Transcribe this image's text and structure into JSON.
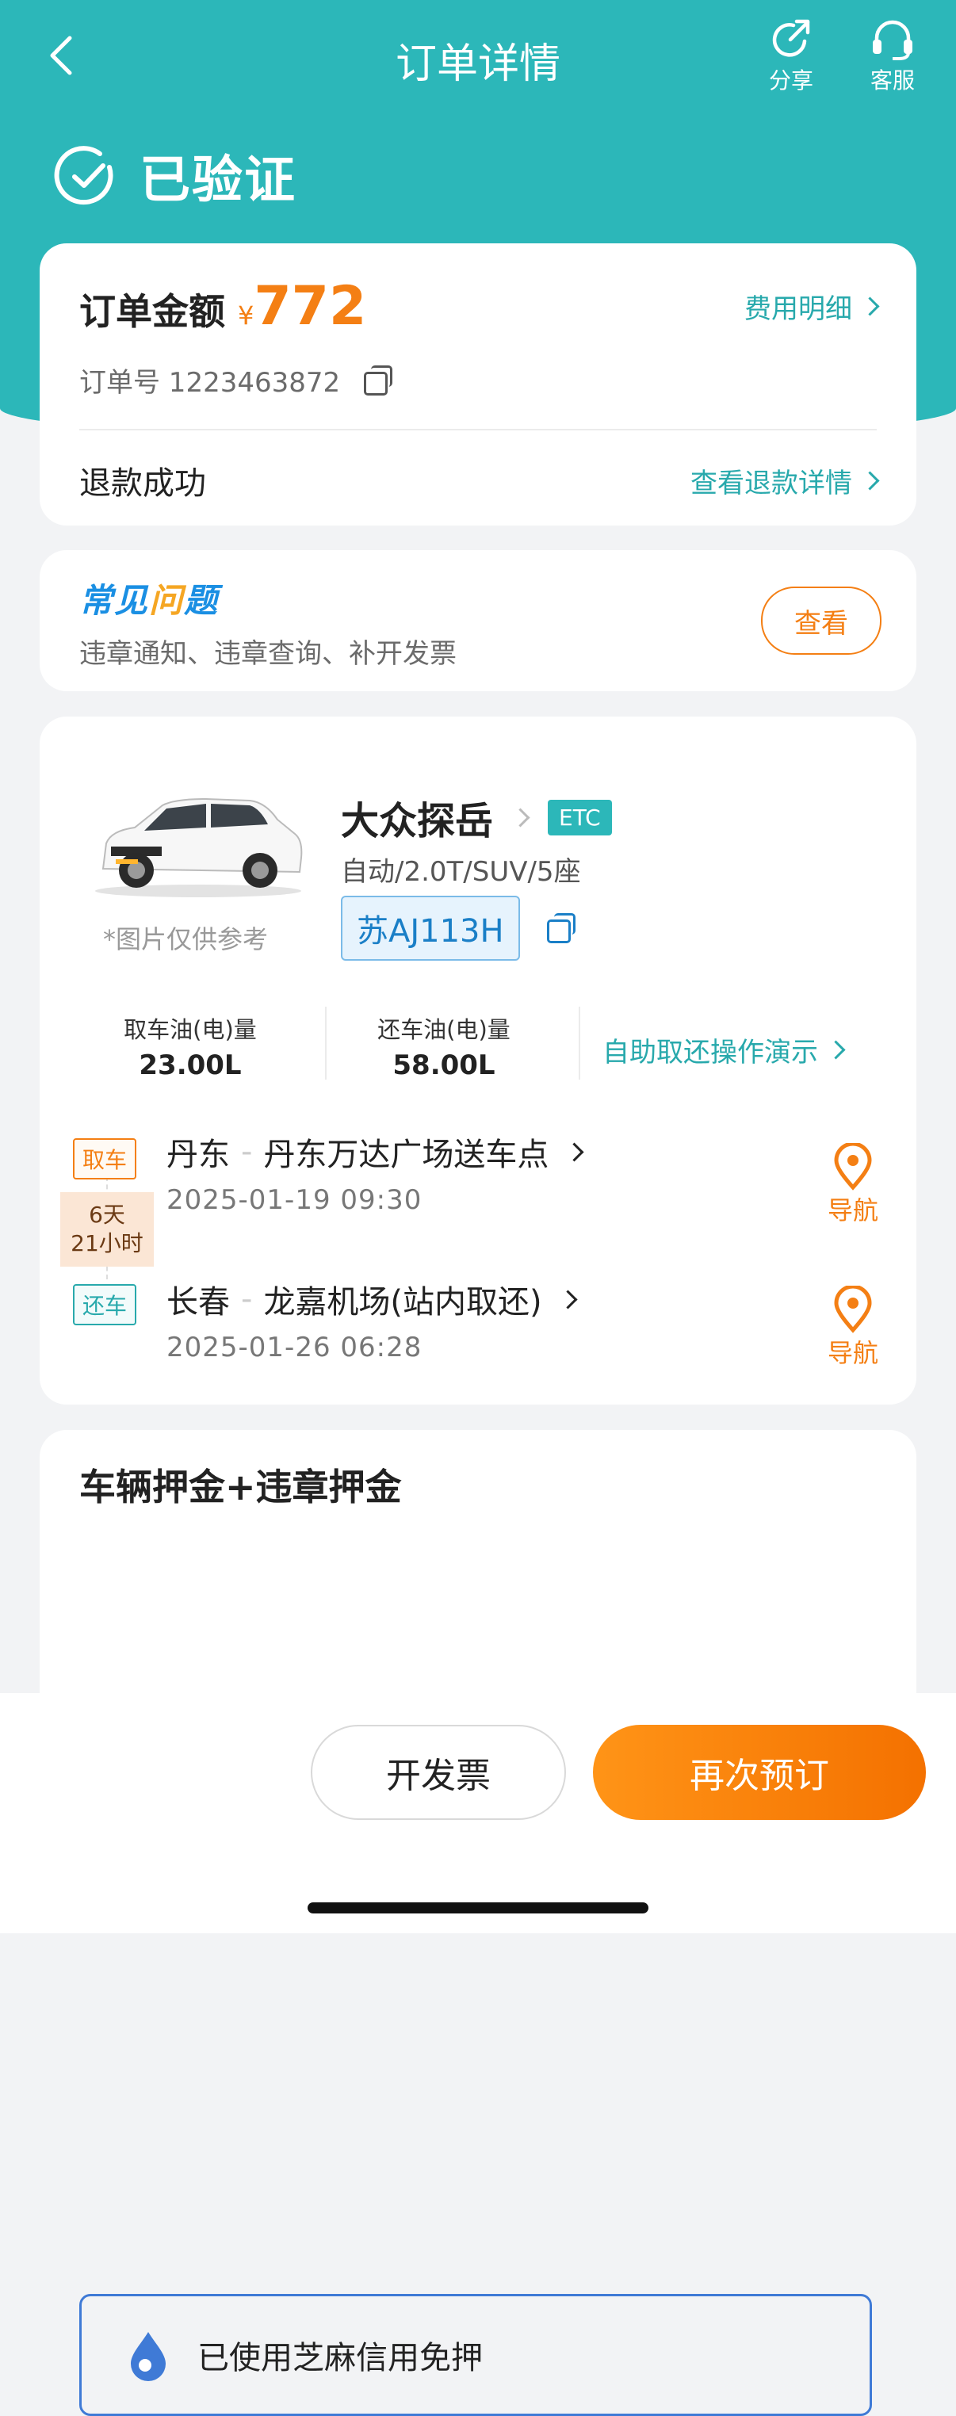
{
  "header": {
    "title": "订单详情",
    "share_label": "分享",
    "service_label": "客服"
  },
  "status": {
    "text": "已验证"
  },
  "order": {
    "amount_label": "订单金额",
    "currency": "¥",
    "amount": "772",
    "fee_detail_link": "费用明细",
    "number_label": "订单号 1223463872",
    "refund_status": "退款成功",
    "refund_link": "查看退款详情"
  },
  "faq": {
    "logo_part1": "常见",
    "logo_part2": "问",
    "logo_part3": "题",
    "desc": "违章通知、违章查询、补开发票",
    "view_button": "查看"
  },
  "car": {
    "name": "大众探岳",
    "etc_badge": "ETC",
    "spec": "自动/2.0T/SUV/5座",
    "plate": "苏AJ113H",
    "image_note": "*图片仅供参考",
    "fuel_pickup_label": "取车油(电)量",
    "fuel_pickup_value": "23.00L",
    "fuel_return_label": "还车油(电)量",
    "fuel_return_value": "58.00L",
    "self_service_link": "自助取还操作演示"
  },
  "trip": {
    "pickup_tag": "取车",
    "pickup_city": "丹东",
    "pickup_location": "丹东万达广场送车点",
    "pickup_time": "2025-01-19 09:30",
    "duration_days": "6天",
    "duration_hours": "21小时",
    "return_tag": "还车",
    "return_city": "长春",
    "return_location": "龙嘉机场(站内取还)",
    "return_time": "2025-01-26 06:28",
    "nav_label": "导航"
  },
  "deposit": {
    "title": "车辆押金+违章押金",
    "zhima_text": "已使用芝麻信用免押"
  },
  "bottom": {
    "invoice_button": "开发票",
    "rebook_button": "再次预订"
  },
  "colors": {
    "teal": "#2cb7b9",
    "orange": "#f47f14",
    "zhima_blue": "#3f7ad6"
  }
}
